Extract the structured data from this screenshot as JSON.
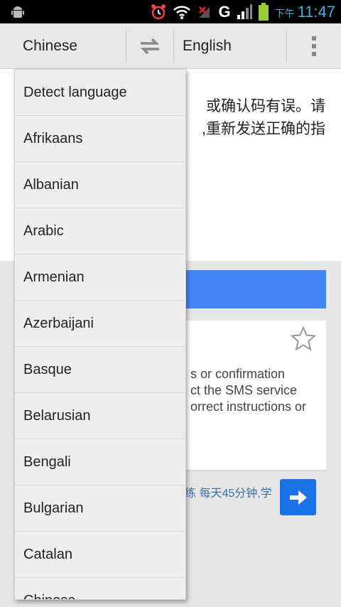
{
  "status_bar": {
    "time_prefix": "下午",
    "time": "11:47",
    "network": "G",
    "icons": [
      "android-icon",
      "alarm-icon",
      "wifi-icon",
      "no-signal-icon",
      "signal-icon",
      "battery-icon"
    ]
  },
  "toolbar": {
    "source_language": "Chinese",
    "target_language": "English"
  },
  "input": {
    "lines": [
      "或确认码有误。请",
      ",重新发送正确的指"
    ]
  },
  "result": {
    "lines": [
      "s or confirmation",
      "ct the SMS service",
      "orrect instructions or"
    ]
  },
  "promo": {
    "text": "练 每天45分钟,学"
  },
  "dropdown": {
    "items": [
      "Detect language",
      "Afrikaans",
      "Albanian",
      "Arabic",
      "Armenian",
      "Azerbaijani",
      "Basque",
      "Belarusian",
      "Bengali",
      "Bulgarian",
      "Catalan",
      "Chinese"
    ]
  },
  "colors": {
    "accent_blue": "#4285f4",
    "button_blue": "#1a73e8",
    "status_time": "#33b5e5"
  }
}
